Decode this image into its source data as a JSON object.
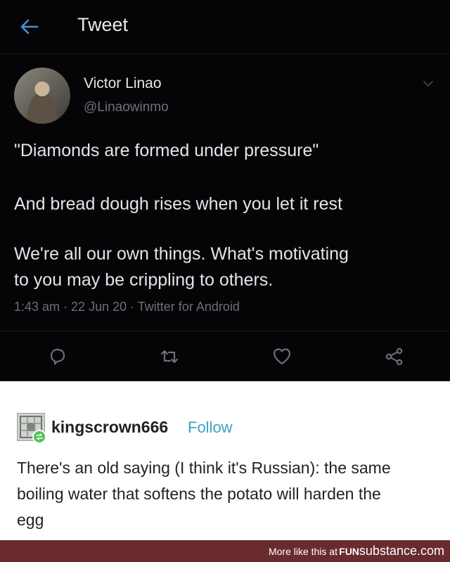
{
  "header": {
    "title": "Tweet",
    "back_icon": "arrow-left-icon"
  },
  "tweet": {
    "author": {
      "name": "Victor Linao",
      "handle": "@Linaowinmo"
    },
    "lines": [
      "\"Diamonds are formed under pressure\"",
      "And bread dough rises when you let it rest",
      "We're all our own things. What's motivating",
      "to you may be crippling to others."
    ],
    "time": "1:43 am",
    "date": "22 Jun 20",
    "app": "Twitter for Android",
    "separator": " · ",
    "actions": [
      "reply-icon",
      "retweet-icon",
      "like-icon",
      "share-icon"
    ]
  },
  "tumblr": {
    "username": "kingscrown666",
    "follow_label": "Follow",
    "lines": [
      "There's an old saying (I think it's Russian): the same",
      "boiling water that softens the potato will harden the",
      "egg"
    ]
  },
  "footer": {
    "more_text": "More like this at",
    "brand_1": "FUN",
    "brand_2": "substance",
    "brand_3": ".com"
  },
  "colors": {
    "twitter_bg": "#050507",
    "accent": "#35a4c6",
    "footer_bg": "#6a2b2f",
    "badge": "#4fc25a"
  }
}
